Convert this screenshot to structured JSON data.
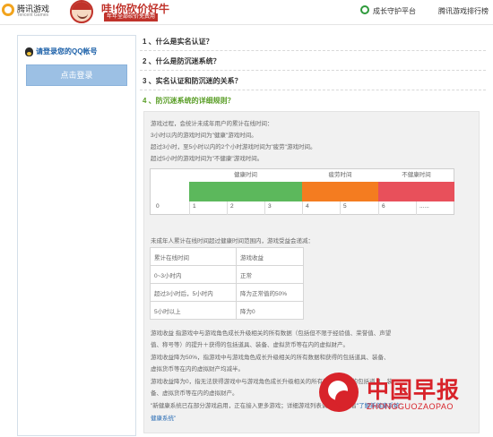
{
  "header": {
    "logo_text": "腾讯游戏",
    "logo_sub": "Tencent Games",
    "banner_title": "哇!你砍价好牛",
    "banner_sub": "年年全部砍价免费用",
    "growth_link": "成长守护平台",
    "rank_link": "腾讯游戏排行榜"
  },
  "login": {
    "title": "请登录您的QQ帐号",
    "button": "点击登录"
  },
  "faq": [
    "1 、什么是实名认证？",
    "2 、什么是防沉迷系统？",
    "3 、实名认证和防沉迷的关系？",
    "4 、防沉迷系统的详细规则？"
  ],
  "answer": {
    "intro": [
      "游戏过程，会统计未成年用户的累计在线时间：",
      "3小时以内的游戏时间为\"健康\"游戏时间。",
      "超过3小时，至5小时以内的2个小时游戏时间为\"疲劳\"游戏时间。",
      "超过5小时的游戏时间为\"不健康\"游戏时间。"
    ],
    "timebar": {
      "labels": [
        "健康时间",
        "疲劳时间",
        "不健康时间"
      ],
      "colors": [
        "#5cb85c",
        "#f47c20",
        "#e8505b"
      ],
      "ticks": [
        "0",
        "1",
        "2",
        "3",
        "4",
        "5",
        "6",
        "......"
      ]
    },
    "table_caption": "未成年人累计在线时间超过健康时间范围内，游戏受益会递减：",
    "table": [
      [
        "累计在线时间",
        "游戏收益"
      ],
      [
        "0~3小时内",
        "正常"
      ],
      [
        "超过3小时后，5小时内",
        "降为正常值的50%"
      ],
      [
        "5小时以上",
        "降为0"
      ]
    ],
    "notes": [
      "游戏收益 指游戏中与游戏角色成长升级相关的所有数据（包括但不限于经验值、荣誉值、声望",
      "值、称号等）的提升＋获得的包括道具、装备、虚拟货币等在内的虚拟财产。",
      "游戏收益降为50%，指游戏中与游戏角色成长升级相关的所有数据和获得的包括道具、装备、",
      "虚拟货币等在内的虚拟财产均减半。",
      "游戏收益降为0，指无法获得游戏中与游戏角色成长升级相关的所有数据和获得的包括道具、装",
      "备、虚拟货币等在内的虚拟财产。",
      "\"新健康系统已在部分游戏启用，正在接入更多游戏；详细游戏列表请点此处查看"
    ],
    "link_tail": "\"了解新健康系统\"",
    "last_line": "健康系统\""
  },
  "watermark": {
    "title": "中国早报",
    "sub": "ZHONGGUOZAOPAO"
  }
}
